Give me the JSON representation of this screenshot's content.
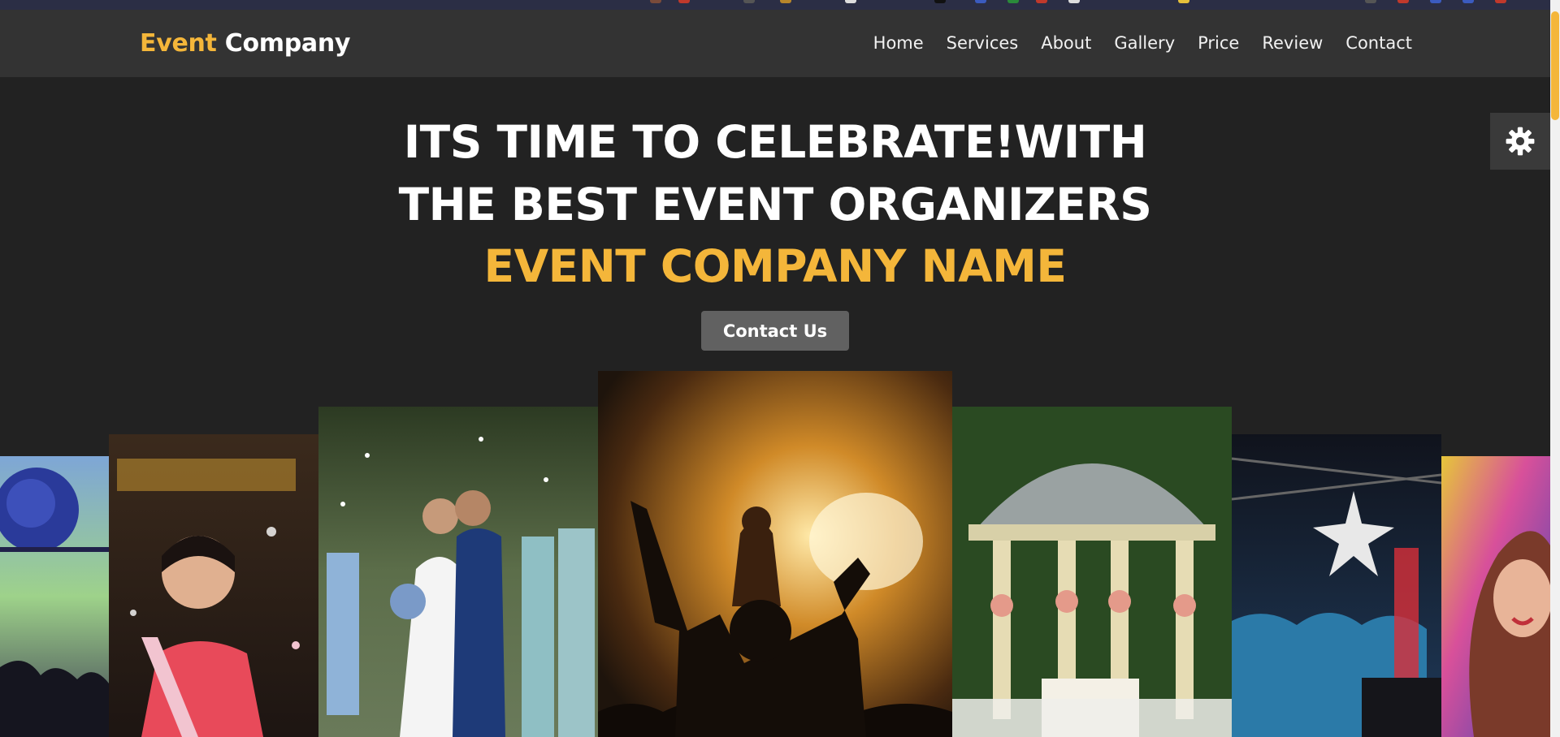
{
  "brand": {
    "part1": "Event",
    "part2": "Company"
  },
  "nav": {
    "items": [
      "Home",
      "Services",
      "About",
      "Gallery",
      "Price",
      "Review",
      "Contact"
    ]
  },
  "hero": {
    "line1": "ITS TIME TO CELEBRATE!WITH",
    "line2": "THE BEST EVENT ORGANIZERS",
    "line3": "EVENT COMPANY NAME",
    "cta": "Contact Us"
  },
  "gallery": {
    "photos": [
      {
        "name": "photo-party-disco-ball",
        "subject": "disco ball party"
      },
      {
        "name": "photo-birthday-girl",
        "subject": "birthday celebration"
      },
      {
        "name": "photo-wedding-couple",
        "subject": "wedding couple"
      },
      {
        "name": "photo-concert-crowd",
        "subject": "concert crowd"
      },
      {
        "name": "photo-garden-gazebo",
        "subject": "garden gazebo"
      },
      {
        "name": "photo-nightclub-dj",
        "subject": "nightclub dj"
      },
      {
        "name": "photo-holi-colors",
        "subject": "color festival"
      }
    ]
  },
  "icons": {
    "settings": "gear-icon"
  },
  "colors": {
    "accent": "#f4b63a",
    "background": "#222222",
    "navbar": "#333333",
    "button": "#616161"
  }
}
